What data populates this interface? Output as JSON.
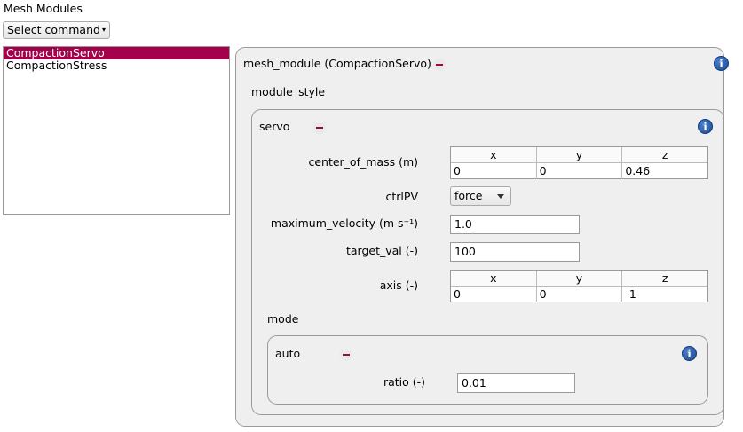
{
  "header": {
    "title": "Mesh Modules",
    "select_command": "Select command"
  },
  "module_list": {
    "items": [
      "CompactionServo",
      "CompactionStress"
    ],
    "selected_index": 0
  },
  "outer_group": {
    "title": "mesh_module (CompactionServo)",
    "module_style_label": "module_style",
    "info_glyph": "i"
  },
  "servo_group": {
    "title": "servo",
    "center_of_mass": {
      "label": "center_of_mass (m)",
      "headers": [
        "x",
        "y",
        "z"
      ],
      "values": [
        "0",
        "0",
        "0.46"
      ]
    },
    "ctrlPV": {
      "label": "ctrlPV",
      "value": "force"
    },
    "maximum_velocity": {
      "label": "maximum_velocity (m s⁻¹)",
      "value": "1.0"
    },
    "target_val": {
      "label": "target_val (-)",
      "value": "100"
    },
    "axis": {
      "label": "axis (-)",
      "headers": [
        "x",
        "y",
        "z"
      ],
      "values": [
        "0",
        "0",
        "-1"
      ]
    },
    "mode_label": "mode"
  },
  "auto_group": {
    "title": "auto",
    "ratio": {
      "label": "ratio (-)",
      "value": "0.01"
    }
  },
  "colors": {
    "accent": "#a4004b",
    "group_bg": "#efefef",
    "info_blue": "#1d4a94"
  }
}
